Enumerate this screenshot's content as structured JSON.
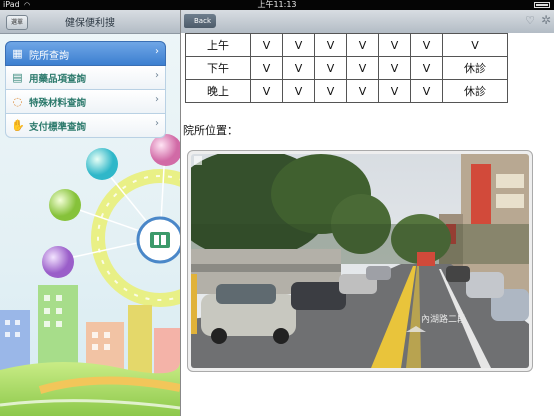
{
  "status_bar": {
    "carrier": "iPad",
    "time": "上午11:13"
  },
  "left_header": {
    "menu_button": "選單",
    "title": "健保便利搜"
  },
  "menu": {
    "items": [
      {
        "label": "院所查詢",
        "icon": "building-icon",
        "active": true
      },
      {
        "label": "用藥品項查詢",
        "icon": "clipboard-icon",
        "active": false
      },
      {
        "label": "特殊材料查詢",
        "icon": "chat-bubble-icon",
        "active": false
      },
      {
        "label": "支付標準查詢",
        "icon": "hand-coins-icon",
        "active": false
      }
    ]
  },
  "right_header": {
    "back_label": "Back",
    "icons": [
      "heart-icon",
      "gear-icon"
    ]
  },
  "schedule": {
    "rows": [
      {
        "label": "上午",
        "cells": [
          "V",
          "V",
          "V",
          "V",
          "V",
          "V",
          "V"
        ]
      },
      {
        "label": "下午",
        "cells": [
          "V",
          "V",
          "V",
          "V",
          "V",
          "V",
          "休診"
        ]
      },
      {
        "label": "晚上",
        "cells": [
          "V",
          "V",
          "V",
          "V",
          "V",
          "V",
          "休診"
        ]
      }
    ]
  },
  "location": {
    "label": "院所位置：",
    "road_marking": "內湖路二段"
  },
  "colors": {
    "active_menu": "#3c7fd0",
    "menu_text": "#2c7a6c",
    "header_bar": "#b3bcc5"
  }
}
